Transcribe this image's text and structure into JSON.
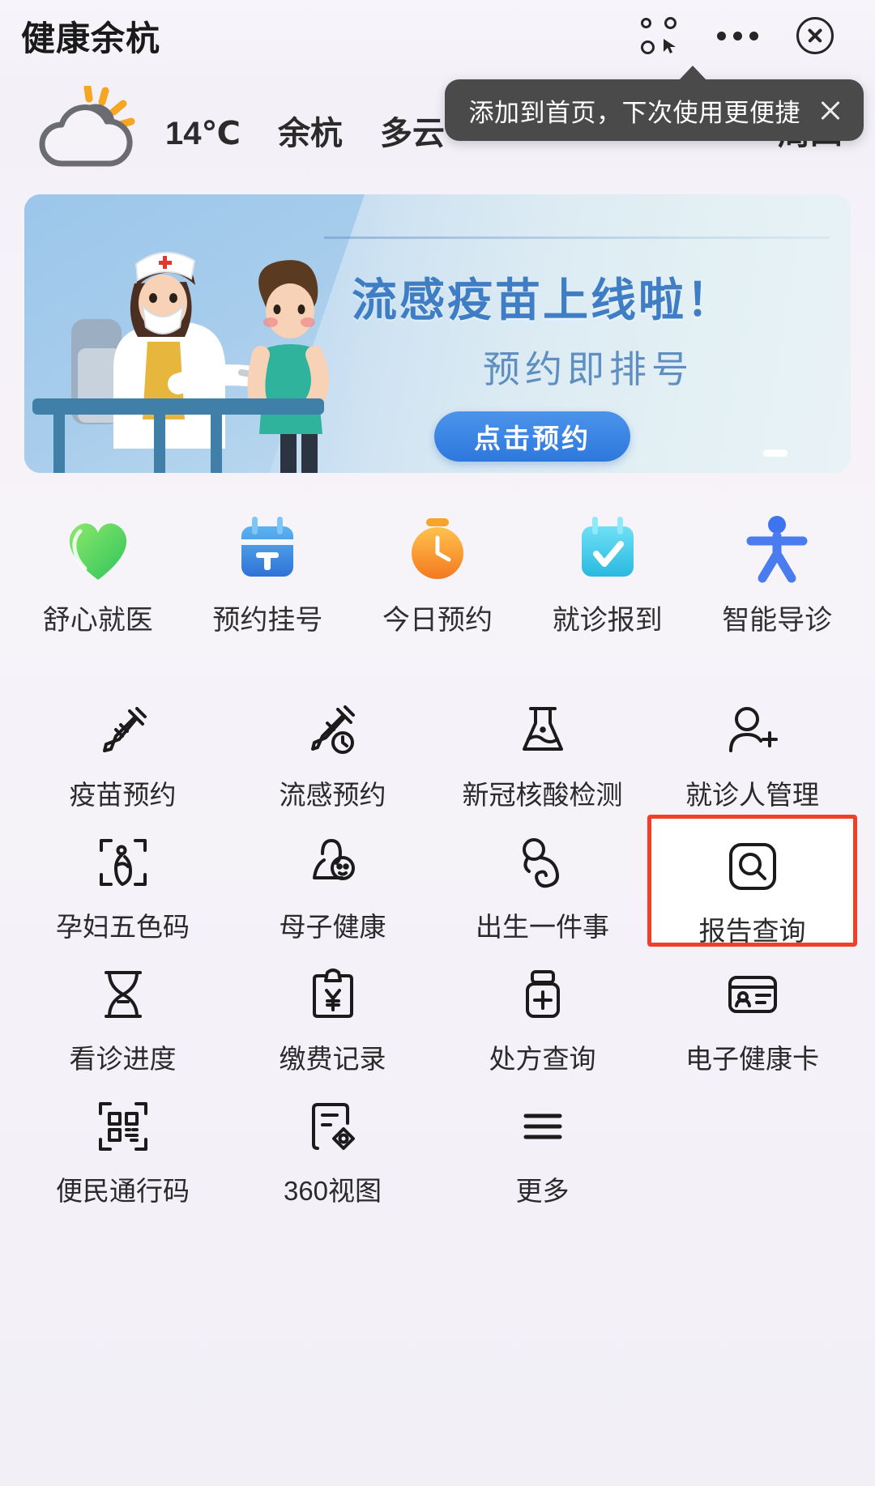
{
  "header": {
    "title": "健康余杭",
    "menu_icon": "mini-program-menu-icon",
    "more_icon": "more-icon",
    "close_icon": "close-icon"
  },
  "tooltip": {
    "text": "添加到首页，下次使用更便捷",
    "close_icon": "tooltip-close-icon"
  },
  "weather": {
    "icon": "partly-cloudy-icon",
    "temperature": "14℃",
    "city": "余杭",
    "condition": "多云",
    "weekday": "周四"
  },
  "banner": {
    "title": "流感疫苗上线啦！",
    "subtitle": "预约即排号",
    "button_label": "点击预约",
    "accent_color": "#3f7ec4",
    "button_color": "#2e78dd"
  },
  "quick_services": [
    {
      "label": "舒心就医",
      "icon": "heart-icon",
      "color": "#5fd35a"
    },
    {
      "label": "预约挂号",
      "icon": "calendar-register-icon",
      "color": "#3a8fe0"
    },
    {
      "label": "今日预约",
      "icon": "clock-icon",
      "color": "#f79c1a"
    },
    {
      "label": "就诊报到",
      "icon": "calendar-check-icon",
      "color": "#45c8e8"
    },
    {
      "label": "智能导诊",
      "icon": "person-guide-icon",
      "color": "#4a7cf0"
    }
  ],
  "services": [
    {
      "label": "疫苗预约",
      "icon": "syringe-icon",
      "highlighted": false
    },
    {
      "label": "流感预约",
      "icon": "syringe-clock-icon",
      "highlighted": false
    },
    {
      "label": "新冠核酸检测",
      "icon": "flask-icon",
      "highlighted": false
    },
    {
      "label": "就诊人管理",
      "icon": "person-add-icon",
      "highlighted": false
    },
    {
      "label": "孕妇五色码",
      "icon": "pregnant-scan-icon",
      "highlighted": false
    },
    {
      "label": "母子健康",
      "icon": "mother-baby-icon",
      "highlighted": false
    },
    {
      "label": "出生一件事",
      "icon": "newborn-icon",
      "highlighted": false
    },
    {
      "label": "报告查询",
      "icon": "report-search-icon",
      "highlighted": true
    },
    {
      "label": "看诊进度",
      "icon": "hourglass-icon",
      "highlighted": false
    },
    {
      "label": "缴费记录",
      "icon": "payment-record-icon",
      "highlighted": false
    },
    {
      "label": "处方查询",
      "icon": "medicine-bottle-icon",
      "highlighted": false
    },
    {
      "label": "电子健康卡",
      "icon": "health-card-icon",
      "highlighted": false
    },
    {
      "label": "便民通行码",
      "icon": "qr-code-icon",
      "highlighted": false
    },
    {
      "label": "360视图",
      "icon": "view-360-icon",
      "highlighted": false
    },
    {
      "label": "更多",
      "icon": "more-lines-icon",
      "highlighted": false
    }
  ],
  "highlight_color": "#f0402a"
}
